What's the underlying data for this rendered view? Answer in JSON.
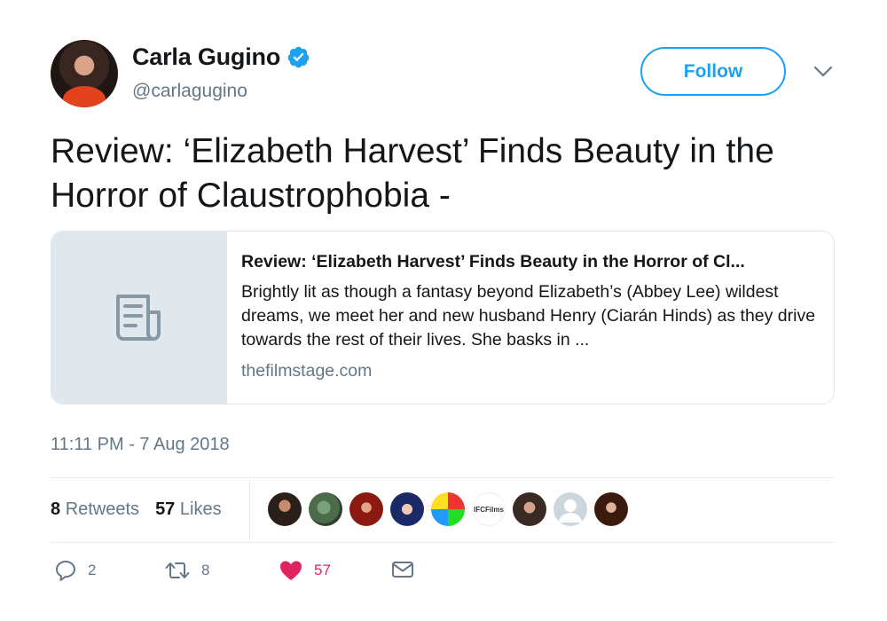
{
  "author": {
    "display_name": "Carla Gugino",
    "handle": "@carlagugino",
    "verified": true
  },
  "follow": {
    "label": "Follow"
  },
  "tweet": {
    "text": "Review: ‘Elizabeth Harvest’ Finds Beauty in the Horror of Claustrophobia -"
  },
  "card": {
    "title": "Review: ‘Elizabeth Harvest’ Finds Beauty in the Horror of Cl...",
    "description": "Brightly lit as though a fantasy beyond Elizabeth’s (Abbey Lee) wildest dreams, we meet her and new husband Henry (Ciarán Hinds) as they drive towards the rest of their lives. She basks in ...",
    "domain": "thefilmstage.com",
    "icon": "document-icon"
  },
  "timestamp": "11:11 PM - 7 Aug 2018",
  "stats": {
    "retweets_count": "8",
    "retweets_label": "Retweets",
    "likes_count": "57",
    "likes_label": "Likes",
    "liker_badge_text": "IFCFilms"
  },
  "actions": {
    "replies": "2",
    "retweets": "8",
    "likes": "57"
  },
  "colors": {
    "accent": "#1da1f2",
    "like": "#e0245e",
    "secondary_text": "#657786",
    "border": "#e1e8ed"
  }
}
